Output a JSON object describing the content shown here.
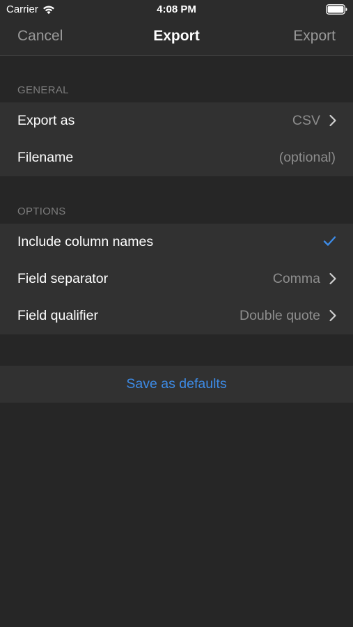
{
  "status_bar": {
    "carrier": "Carrier",
    "time": "4:08 PM"
  },
  "nav": {
    "cancel_label": "Cancel",
    "title": "Export",
    "export_label": "Export"
  },
  "sections": {
    "general": {
      "header": "GENERAL",
      "export_as": {
        "label": "Export as",
        "value": "CSV"
      },
      "filename": {
        "label": "Filename",
        "placeholder": "(optional)"
      }
    },
    "options": {
      "header": "OPTIONS",
      "include_column_names": {
        "label": "Include column names",
        "checked": true
      },
      "field_separator": {
        "label": "Field separator",
        "value": "Comma"
      },
      "field_qualifier": {
        "label": "Field qualifier",
        "value": "Double quote"
      }
    }
  },
  "actions": {
    "save_defaults_label": "Save as defaults"
  },
  "colors": {
    "background": "#262626",
    "cell_background": "#313131",
    "accent": "#3d8be6",
    "secondary_text": "#8d8d8d"
  },
  "icons": {
    "wifi": "wifi-icon",
    "battery": "battery-icon",
    "chevron": "chevron-right-icon",
    "check": "checkmark-icon"
  }
}
